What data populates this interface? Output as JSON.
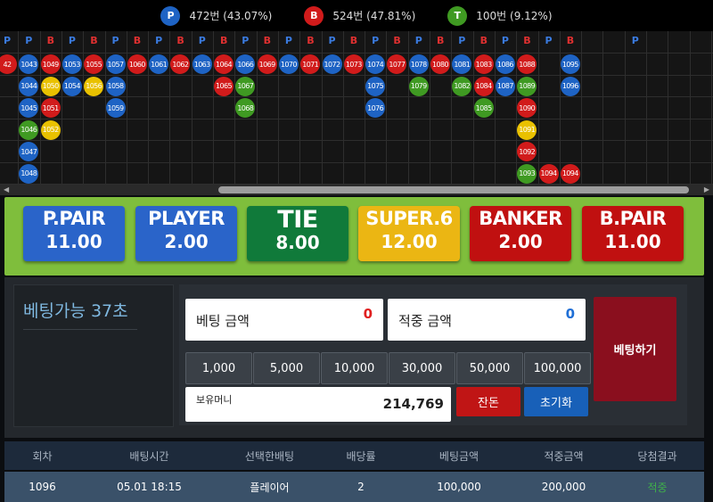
{
  "stats": [
    {
      "badge": "P",
      "label": "472번 (43.07%)",
      "color": "#1e63c4"
    },
    {
      "badge": "B",
      "label": "524번 (47.81%)",
      "color": "#d11b1b"
    },
    {
      "badge": "T",
      "label": "100번 (9.12%)",
      "color": "#3f9a22"
    }
  ],
  "road_header": [
    "P",
    "P",
    "B",
    "P",
    "B",
    "P",
    "B",
    "P",
    "B",
    "P",
    "B",
    "P",
    "B",
    "P",
    "B",
    "P",
    "B",
    "P",
    "B",
    "P",
    "B",
    "P",
    "B",
    "P",
    "B",
    "P",
    "B",
    "",
    "",
    "P"
  ],
  "road": [
    {
      "col": 0,
      "row": 0,
      "label": "42",
      "color": "#d11b1b"
    },
    {
      "col": 1,
      "row": 0,
      "label": "1043",
      "color": "#1e63c4"
    },
    {
      "col": 1,
      "row": 1,
      "label": "1044",
      "color": "#1e63c4"
    },
    {
      "col": 1,
      "row": 2,
      "label": "1045",
      "color": "#1e63c4"
    },
    {
      "col": 1,
      "row": 3,
      "label": "1046",
      "color": "#3f9a22"
    },
    {
      "col": 1,
      "row": 4,
      "label": "1047",
      "color": "#1e63c4"
    },
    {
      "col": 1,
      "row": 5,
      "label": "1048",
      "color": "#1e63c4"
    },
    {
      "col": 2,
      "row": 0,
      "label": "1049",
      "color": "#d11b1b"
    },
    {
      "col": 2,
      "row": 1,
      "label": "1050",
      "color": "#e9c100"
    },
    {
      "col": 2,
      "row": 2,
      "label": "1051",
      "color": "#d11b1b"
    },
    {
      "col": 2,
      "row": 3,
      "label": "1052",
      "color": "#e9c100"
    },
    {
      "col": 3,
      "row": 0,
      "label": "1053",
      "color": "#1e63c4"
    },
    {
      "col": 3,
      "row": 1,
      "label": "1054",
      "color": "#1e63c4"
    },
    {
      "col": 4,
      "row": 0,
      "label": "1055",
      "color": "#d11b1b"
    },
    {
      "col": 4,
      "row": 1,
      "label": "1056",
      "color": "#e9c100"
    },
    {
      "col": 5,
      "row": 0,
      "label": "1057",
      "color": "#1e63c4"
    },
    {
      "col": 5,
      "row": 1,
      "label": "1058",
      "color": "#1e63c4"
    },
    {
      "col": 5,
      "row": 2,
      "label": "1059",
      "color": "#1e63c4"
    },
    {
      "col": 6,
      "row": 0,
      "label": "1060",
      "color": "#d11b1b"
    },
    {
      "col": 7,
      "row": 0,
      "label": "1061",
      "color": "#1e63c4"
    },
    {
      "col": 8,
      "row": 0,
      "label": "1062",
      "color": "#d11b1b"
    },
    {
      "col": 9,
      "row": 0,
      "label": "1063",
      "color": "#1e63c4"
    },
    {
      "col": 10,
      "row": 0,
      "label": "1064",
      "color": "#d11b1b"
    },
    {
      "col": 10,
      "row": 1,
      "label": "1065",
      "color": "#d11b1b"
    },
    {
      "col": 11,
      "row": 0,
      "label": "1066",
      "color": "#1e63c4"
    },
    {
      "col": 11,
      "row": 1,
      "label": "1067",
      "color": "#3f9a22"
    },
    {
      "col": 11,
      "row": 2,
      "label": "1068",
      "color": "#3f9a22"
    },
    {
      "col": 12,
      "row": 0,
      "label": "1069",
      "color": "#d11b1b"
    },
    {
      "col": 13,
      "row": 0,
      "label": "1070",
      "color": "#1e63c4"
    },
    {
      "col": 14,
      "row": 0,
      "label": "1071",
      "color": "#d11b1b"
    },
    {
      "col": 15,
      "row": 0,
      "label": "1072",
      "color": "#1e63c4"
    },
    {
      "col": 16,
      "row": 0,
      "label": "1073",
      "color": "#d11b1b"
    },
    {
      "col": 17,
      "row": 0,
      "label": "1074",
      "color": "#1e63c4"
    },
    {
      "col": 17,
      "row": 1,
      "label": "1075",
      "color": "#1e63c4"
    },
    {
      "col": 17,
      "row": 2,
      "label": "1076",
      "color": "#1e63c4"
    },
    {
      "col": 18,
      "row": 0,
      "label": "1077",
      "color": "#d11b1b"
    },
    {
      "col": 19,
      "row": 0,
      "label": "1078",
      "color": "#1e63c4"
    },
    {
      "col": 19,
      "row": 1,
      "label": "1079",
      "color": "#3f9a22"
    },
    {
      "col": 20,
      "row": 0,
      "label": "1080",
      "color": "#d11b1b"
    },
    {
      "col": 21,
      "row": 0,
      "label": "1081",
      "color": "#1e63c4"
    },
    {
      "col": 21,
      "row": 1,
      "label": "1082",
      "color": "#3f9a22"
    },
    {
      "col": 22,
      "row": 0,
      "label": "1083",
      "color": "#d11b1b"
    },
    {
      "col": 22,
      "row": 1,
      "label": "1084",
      "color": "#d11b1b"
    },
    {
      "col": 22,
      "row": 2,
      "label": "1085",
      "color": "#3f9a22"
    },
    {
      "col": 23,
      "row": 0,
      "label": "1086",
      "color": "#1e63c4"
    },
    {
      "col": 23,
      "row": 1,
      "label": "1087",
      "color": "#1e63c4"
    },
    {
      "col": 24,
      "row": 0,
      "label": "1088",
      "color": "#d11b1b"
    },
    {
      "col": 24,
      "row": 1,
      "label": "1089",
      "color": "#3f9a22"
    },
    {
      "col": 24,
      "row": 2,
      "label": "1090",
      "color": "#d11b1b"
    },
    {
      "col": 24,
      "row": 3,
      "label": "1091",
      "color": "#e9c100"
    },
    {
      "col": 24,
      "row": 4,
      "label": "1092",
      "color": "#d11b1b"
    },
    {
      "col": 24,
      "row": 5,
      "label": "1093",
      "color": "#3f9a22"
    },
    {
      "col": 25,
      "row": 5,
      "label": "1094",
      "color": "#d11b1b"
    },
    {
      "col": 26,
      "row": 5,
      "label": "1094",
      "color": "#d11b1b"
    },
    {
      "col": 26,
      "row": 0,
      "label": "1095",
      "color": "#1e63c4"
    },
    {
      "col": 26,
      "row": 1,
      "label": "1096",
      "color": "#1e63c4"
    }
  ],
  "bet_options": [
    {
      "name": "P.PAIR",
      "odds": "11.00",
      "color": "#2a64c9"
    },
    {
      "name": "PLAYER",
      "odds": "2.00",
      "color": "#2a64c9"
    },
    {
      "name": "TIE",
      "odds": "8.00",
      "color": "#107a3a"
    },
    {
      "name": "SUPER.6",
      "odds": "12.00",
      "color": "#ebb613"
    },
    {
      "name": "BANKER",
      "odds": "2.00",
      "color": "#c01010"
    },
    {
      "name": "B.PAIR",
      "odds": "11.00",
      "color": "#c01010"
    }
  ],
  "timer_text": "베팅가능 37초",
  "bet_amount": {
    "label": "베팅 금액",
    "value": "0"
  },
  "win_amount": {
    "label": "적중 금액",
    "value": "0"
  },
  "chips": [
    "1,000",
    "5,000",
    "10,000",
    "30,000",
    "50,000",
    "100,000"
  ],
  "balance": {
    "label": "보유머니",
    "value": "214,769"
  },
  "change_btn": "잔돈",
  "reset_btn": "초기화",
  "place_bet_btn": "베팅하기",
  "history": {
    "headers": [
      "회차",
      "배팅시간",
      "선택한배팅",
      "배당률",
      "베팅금액",
      "적중금액",
      "당첨결과"
    ],
    "rows": [
      [
        "1096",
        "05.01 18:15",
        "플레이어",
        "2",
        "100,000",
        "200,000",
        "적중"
      ]
    ]
  }
}
